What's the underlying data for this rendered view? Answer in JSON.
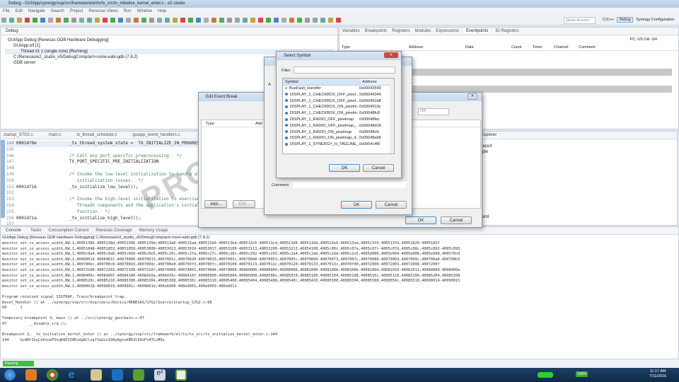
{
  "window": {
    "title": "Debug - GUIApp/synergy/ssp/src/framework/el/tx/tx_src/tx_initialize_kernel_enter.c - e2 studio"
  },
  "menu": [
    "File",
    "Edit",
    "Navigate",
    "Search",
    "Project",
    "Renesas Views",
    "Run",
    "Window",
    "Help"
  ],
  "toolbar": {
    "quick_access": "Quick Access",
    "perspectives": [
      "C/C++",
      "Debug",
      "Synergy Configuration"
    ]
  },
  "debug_view": {
    "tab": "Debug",
    "tree": [
      "GUIApp Debug [Renesas GDB Hardware Debugging]",
      "GUIApp.elf [1]",
      "Thread #1 1 (single core) (Running)",
      "C:/Renesas/e2_studio_v5/DebugComp/arm-none-eabi-gdb (7.8.2)",
      "GDB server"
    ]
  },
  "right_view": {
    "tabs": [
      "Variables",
      "Breakpoints",
      "Registers",
      "Modules",
      "Expressions",
      "Eventpoints",
      "IO Registers"
    ],
    "active": "Eventpoints",
    "pc_oa": "PC: 0/6 OA: 0/4",
    "columns": [
      "Type",
      "Address",
      "Data",
      "Count",
      "Timer",
      "Channel",
      "Comment"
    ]
  },
  "editor": {
    "tabs": [
      "startup_S7G2.c",
      "main.c",
      "tx_thread_schedule.c",
      "guiapp_event_handlers.c"
    ],
    "lines": [
      {
        "n": "144",
        "addr": "0001470e",
        "code": "        _tx_thread_system_state =  TX_INITIALIZE_IN_PROGRESS;",
        "c": false
      },
      {
        "n": "145",
        "addr": "",
        "code": "",
        "c": false
      },
      {
        "n": "146",
        "addr": "",
        "code": "        /* Call any port specific preprocessing.  */",
        "c": true
      },
      {
        "n": "147",
        "addr": "",
        "code": "        TX_PORT_SPECIFIC_PRE_INITIALIZATION",
        "c": false
      },
      {
        "n": "148",
        "addr": "",
        "code": "",
        "c": false
      },
      {
        "n": "149",
        "addr": "",
        "code": "        /* Invoke the low-level initialization to handle all processor specific",
        "c": true
      },
      {
        "n": "150",
        "addr": "",
        "code": "           initialization issues.  */",
        "c": true
      },
      {
        "n": "151",
        "addr": "00014716",
        "code": "        _tx_initialize_low_level();",
        "c": false
      },
      {
        "n": "152",
        "addr": "",
        "code": "",
        "c": false
      },
      {
        "n": "153",
        "addr": "",
        "code": "        /* Invoke the high-level initialization to exercise all of the",
        "c": true
      },
      {
        "n": "154",
        "addr": "",
        "code": "           ThreadX components and the application's initialization",
        "c": true
      },
      {
        "n": "155",
        "addr": "",
        "code": "           function.  */",
        "c": true
      },
      {
        "n": "156",
        "addr": "0001471a",
        "code": "        _tx_initialize_high_level();",
        "c": false
      },
      {
        "n": "157",
        "addr": "",
        "code": "",
        "c": false
      }
    ]
  },
  "watermark": "PROTECT",
  "explorer": {
    "tab": "Explorer",
    "items": [
      "TraceX",
      "mple"
    ],
    "file": "n.xml"
  },
  "console": {
    "tabs": [
      "Console",
      "Tasks",
      "Consumption Current",
      "Renesas Coverage",
      "Memory Usage"
    ],
    "header": "GUIApp Debug [Renesas GDB Hardware Debugging] C:/Renesas/e2_studio_v5/DebugComp/arm-none-eabi-gdb (7.8.2)",
    "lines": [
      "monitor set_io_access_width,RW,1,40051386-4005138d,40051396-4005139d,400513a6-400513ad,400513b6-400513bd,400513c6-400513cd,400513d6-400513dd,400513e6-400513ed,400513f6-400513fd,40051820-4005183f",
      "monitor set_io_access_width,RW,1,40051848-40051853,40051858,40053000-40053013,40053016-40053017,40053100-40053113,40053200-40053213,40054100,4005c00c,4005c07a,4005c07c-4005c07d,4005c08c,4005c092-4005c093",
      "monitor set_io_access_width,RW,1,4005c0a4,4005c0a6,4005c0dd-4005c0e5,4005c20c,4005c27a,4005c27c,4005c28c,4005c292-4005c293,4005c2a4,4005c2a6,4005c2dd-4005c2e5,4005d000,4005e004-4005e006,4005e008,4005f0c0",
      "monitor set_io_access_width,RW,1,40060014-4006001f,40070000-40070013,4007001c,40070020-40070033,4007003c,40070040-40070053,4007005c,40070060-40070073,4007007c,40070080-40070093,4007009c,400700a0-400700b3",
      "monitor set_io_access_width,RW,1,400700bc,400700c0-400700d3,400700dc,400700e0-400700f3,400700fc,40070100-40070113,4007011c,40070120-40070133,4007013c,40070f00,40072000-40072003,40072008-4007200f",
      "monitor set_io_access_width,RW,1,40072100-40072103,40072108-4007210f,40074000-40074001,40074004,40074008,40080000,40080004,40080008,40081000-40081008,4008100b-4008100d,40081010-40081011,40084008-4008400a",
      "monitor set_io_access_width,RW,1,4008400c-4008400f,40084100-4008410a,4008410c-4008410f,40085000,40085004,40085008,4008500c,40085010,40085100,40085104,40085108,4008510c,40085110,40085200,40085204,40085208",
      "monitor set_io_access_width,RW,1,4008520c,40085210,40085300,40085304,40085308,4008530c,40085310,40085400,40085404,40085408,4008540c,40085410,40085500,40085504,40085508,4008550c,40085510,40090014-40090015",
      "monitor set_io_access_width,RW,1,40090018-40090019,4009001c-4009001d,400e6000-400e6001,400e6003-400e6011",
      "",
      "Program received signal SIGTRAP, Trace/breakpoint trap.",
      "Reset_Handler () at ../synergy/ssp/src/bsp/cmsis/Device/RENESAS/S7G2/Source/startup_S7G2.c:60",
      "60      {",
      "",
      "Temporary breakpoint 4, main () at ../src/synergy_gen/main.c:47",
      "47          __disable_irq ();",
      "",
      "Breakpoint 2, _tx_initialize_kernel_enter () at ../synergy/ssp/src/framework/el/tx/tx_src/tx_initialize_kernel_enter.c:144",
      "144     Gx4RfIkyLkXvueFUvqKQOII8Exdg6Clzg7twGxz1Q9yAg+okREdlIHzFv4TLcM6o"
    ]
  },
  "status": {
    "text": "Running",
    "color": "#3fbf3f"
  },
  "edit_event_break": {
    "title": "Edit Event Break",
    "columns": [
      "Type",
      "Add"
    ],
    "add": "Add...",
    "edit": "Edit...",
    "ok": "OK",
    "cancel": "Cancel",
    "combo": "OR"
  },
  "middle_dialog": {
    "label_a": "A",
    "comment": "Comment:",
    "ok": "OK",
    "cancel": "Cancel"
  },
  "select_symbol": {
    "title": "Select Symbol",
    "filter_label": "Filter:",
    "filter_value": "",
    "columns": [
      "Symbol",
      "Address"
    ],
    "rows": [
      {
        "s": "BusFault_Handler",
        "a": "0x00043549"
      },
      {
        "s": "DISPLAY_1_CHECKBOX_OFF_pixel...",
        "a": "0x00049344"
      },
      {
        "s": "DISPLAY_1_CHECKBOX_OFF_pixel...",
        "a": "0x000491b8"
      },
      {
        "s": "DISPLAY_1_CHECKBOX_ON_pixelm...",
        "a": "0x0004919c"
      },
      {
        "s": "DISPLAY_1_CHECKBOX_ON_pixelm...",
        "a": "0x00048fc8"
      },
      {
        "s": "DISPLAY_1_RADIO_OFF_pixelmap",
        "a": "0x00048fac"
      },
      {
        "s": "DISPLAY_1_RADIO_OFF_pixelmap_...",
        "a": "0x00048d18"
      },
      {
        "s": "DISPLAY_1_RADIO_ON_pixelmap",
        "a": "0x00048cfc"
      },
      {
        "s": "DISPLAY_1_RADIO_ON_pixelmap_d...",
        "a": "0x00048a68"
      },
      {
        "s": "DISPLAY_1_SYNERGY_H_TAGLINE_...",
        "a": "0x0004c4f8"
      }
    ],
    "ok": "OK",
    "cancel": "Cancel"
  },
  "tray": {
    "battery": "100%",
    "time": "11:17 AM",
    "date": "7/11/2016"
  }
}
